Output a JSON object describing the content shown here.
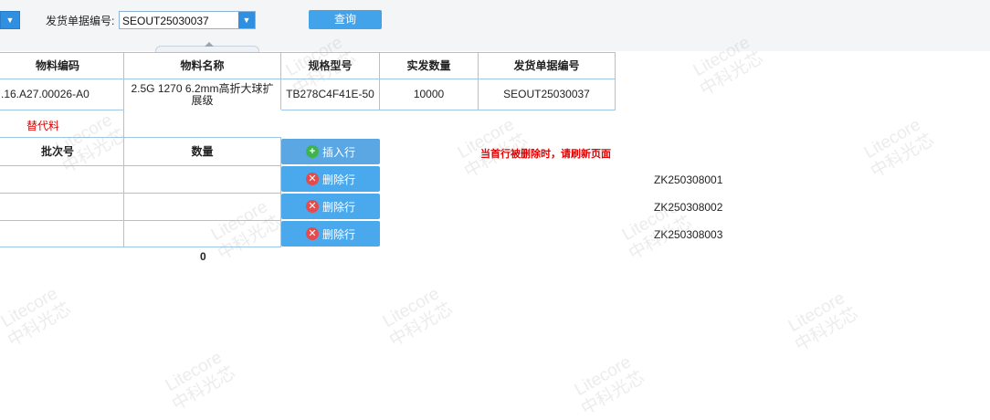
{
  "filter": {
    "label": "发货单据编号",
    "colon": ":",
    "value": "SEOUT25030037",
    "dropdown_icon": "chevron-down-icon",
    "query_label": "查询"
  },
  "main_table": {
    "headers": [
      "物料编码",
      "物料名称",
      "规格型号",
      "实发数量",
      "发货单据编号"
    ],
    "row": {
      "material_code": ".16.A27.00026-A0",
      "material_name_line1": "2.5G 1270 6.2mm高折大球扩",
      "material_name_line2": "展级",
      "spec": "TB278C4F41E-50",
      "qty": "10000",
      "doc_no": "SEOUT25030037"
    }
  },
  "substitute_label": "替代料",
  "sub_table": {
    "headers": [
      "批次号",
      "数量"
    ],
    "total": "0"
  },
  "actions": {
    "insert_label": "插入行",
    "delete_label": "删除行"
  },
  "warning": "当首行被删除时，请刷新页面",
  "lot_numbers": [
    "ZK250308001",
    "ZK250308002",
    "ZK250308003"
  ],
  "watermark": {
    "line1": "Litecore",
    "line2": "中科光芯"
  },
  "colors": {
    "accent": "#43a3ea",
    "warning": "#e00000",
    "add_icon": "#3fb34f",
    "delete_icon": "#e64b4b"
  }
}
